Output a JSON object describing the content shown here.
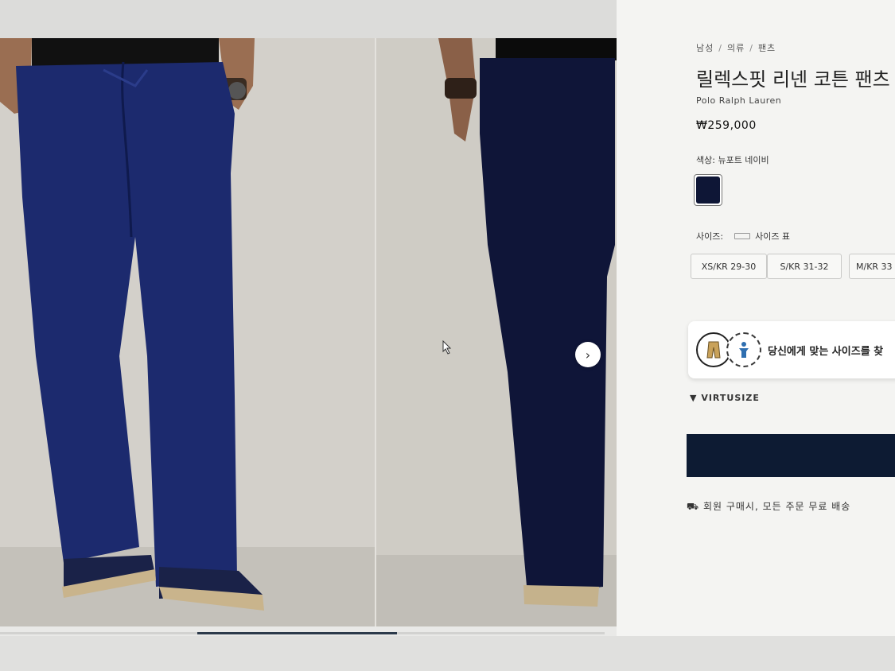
{
  "gallery": {
    "next_icon": "chevron-right",
    "next_glyph": "›",
    "progress": 0.33
  },
  "product": {
    "breadcrumb": [
      "남성",
      "의류",
      "팬츠"
    ],
    "breadcrumb_separator": "/",
    "title": "릴렉스핏 리넨 코튼 팬츠",
    "brand": "Polo Ralph Lauren",
    "price": "₩259,000",
    "color_label": "색상:",
    "color_value": "뉴포트 네이비",
    "swatch_color": "#0e1636",
    "size_label": "사이즈:",
    "size_chart_label": "사이즈 표",
    "sizes": [
      "XS/KR 29-30",
      "S/KR 31-32",
      "M/KR 33"
    ],
    "fit_finder_text": "당신에게 맞는 사이즈를 찾",
    "virtusize_label": "VIRTUSIZE",
    "add_to_cart_color": "#0d1b33",
    "shipping_text": "회원 구매시, 모든 주문 무료 배송"
  }
}
